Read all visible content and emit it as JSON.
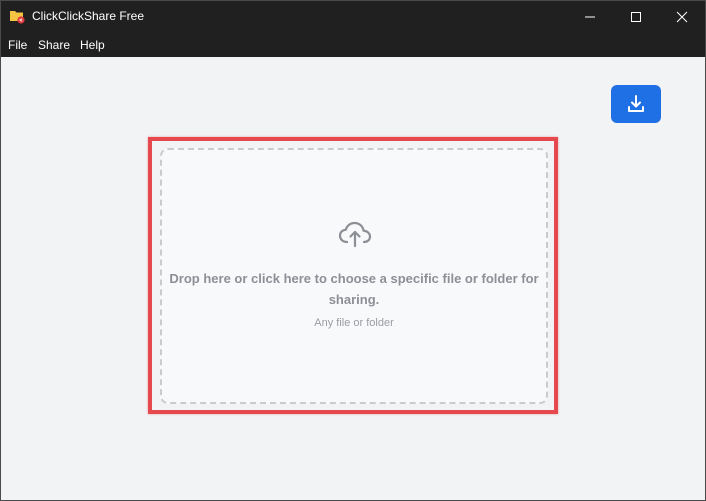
{
  "window": {
    "title": "ClickClickShare Free"
  },
  "menu": {
    "file": "File",
    "share": "Share",
    "help": "Help"
  },
  "dropzone": {
    "main_text": "Drop here or click here to choose a specific file or folder for sharing.",
    "sub_text": "Any file or folder"
  },
  "icons": {
    "app": "folder-share-icon",
    "download": "download-icon",
    "upload": "cloud-upload-icon"
  },
  "colors": {
    "accent": "#1f6fe5",
    "highlight": "#e5484d",
    "titlebar": "#202020"
  }
}
